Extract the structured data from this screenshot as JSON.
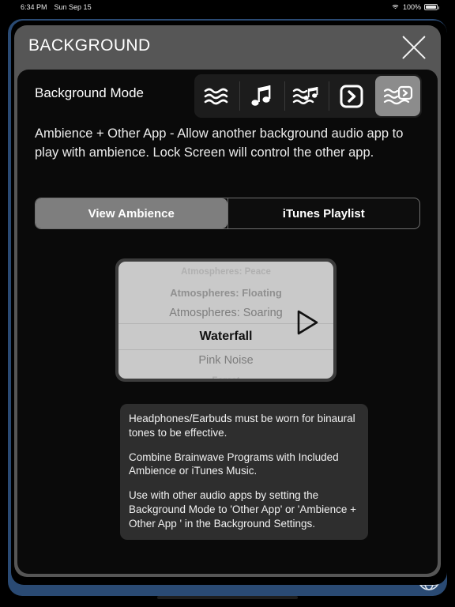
{
  "statusbar": {
    "time": "6:34 PM",
    "date": "Sun Sep 15",
    "battery_percent": "100%",
    "wifi_icon": "wifi-icon",
    "battery_icon": "battery-icon"
  },
  "modal": {
    "title": "BACKGROUND",
    "close_icon": "close-icon"
  },
  "background_mode": {
    "label": "Background Mode",
    "options": [
      {
        "id": "ambience",
        "icon": "waves-icon",
        "selected": false
      },
      {
        "id": "itunes",
        "icon": "music-note-icon",
        "selected": false
      },
      {
        "id": "ambience-itunes",
        "icon": "waves-music-note-icon",
        "selected": false
      },
      {
        "id": "other-app",
        "icon": "chevron-right-box-icon",
        "selected": false
      },
      {
        "id": "ambience-other-app",
        "icon": "waves-chevron-box-icon",
        "selected": true
      }
    ],
    "description": "Ambience + Other App - Allow another background audio app to play with ambience. Lock Screen will control the other app."
  },
  "tabs": [
    {
      "label": "View Ambience",
      "active": true
    },
    {
      "label": "iTunes Playlist",
      "active": false
    }
  ],
  "ambience_picker": {
    "play_icon": "play-triangle-icon",
    "items": [
      {
        "label": "Atmospheres: Peace",
        "state": "far"
      },
      {
        "label": "Atmospheres: Floating",
        "state": "dim"
      },
      {
        "label": "Atmospheres: Soaring",
        "state": "near"
      },
      {
        "label": "Waterfall",
        "state": "selected"
      },
      {
        "label": "Pink Noise",
        "state": "near"
      },
      {
        "label": "Forest",
        "state": "far"
      }
    ],
    "selected_value": "Waterfall"
  },
  "info_box": {
    "paragraphs": [
      "Headphones/Earbuds must be worn for binaural tones to be effective.",
      "Combine Brainwave Programs with Included Ambience or iTunes Music.",
      "Use with other audio apps by setting the Background Mode to 'Other App' or 'Ambience + Other App ' in the Background Settings."
    ]
  },
  "bottom_bar": {
    "globe_icon": "globe-icon",
    "accent_color": "#2a4a73"
  },
  "colors": {
    "modal_bg": "#565656",
    "panel_bg": "#0a0a0a",
    "selection_gray": "#8c8c8c",
    "picker_bg": "#c9c9c9",
    "info_bg": "#2e2e2e"
  }
}
